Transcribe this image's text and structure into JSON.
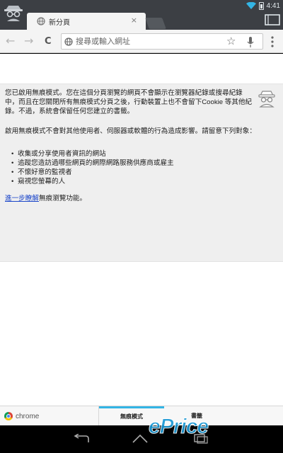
{
  "status": {
    "time": "4:41"
  },
  "tab": {
    "title": "新分頁",
    "close": "×"
  },
  "toolbar": {
    "back": "←",
    "forward": "→",
    "reload": "C",
    "omnibox_placeholder": "搜尋或輸入網址",
    "star": "☆"
  },
  "incognito": {
    "paragraph1": "您已啟用無痕模式。您在這個分頁瀏覽的網頁不會顯示在瀏覽器紀錄或搜尋紀錄中，而且在您關閉所有無痕模式分頁之後，行動裝置上也不會留下Cookie 等其他紀錄。不過，系統會保留任何您建立的書籤。",
    "paragraph2": "啟用無痕模式不會對其他使用者、伺服器或軟體的行為造成影響。請留意下列對象：",
    "bullets": [
      "收集或分享使用者資訊的網站",
      "追蹤您造訪過哪些網頁的網際網路服務供應商或雇主",
      "不懷好意的監視者",
      "窺視您螢幕的人"
    ],
    "learn_more_link": "進一步瞭解",
    "learn_more_suffix": "無痕瀏覽功能。"
  },
  "bottom_bar": {
    "brand": "chrome",
    "tab_incognito": "無痕模式",
    "tab_bookmarks": "書籤"
  },
  "watermark": "ePrice",
  "colors": {
    "accent": "#33b5e5",
    "link": "#1a45c9",
    "tabstrip": "#3c3f44"
  }
}
